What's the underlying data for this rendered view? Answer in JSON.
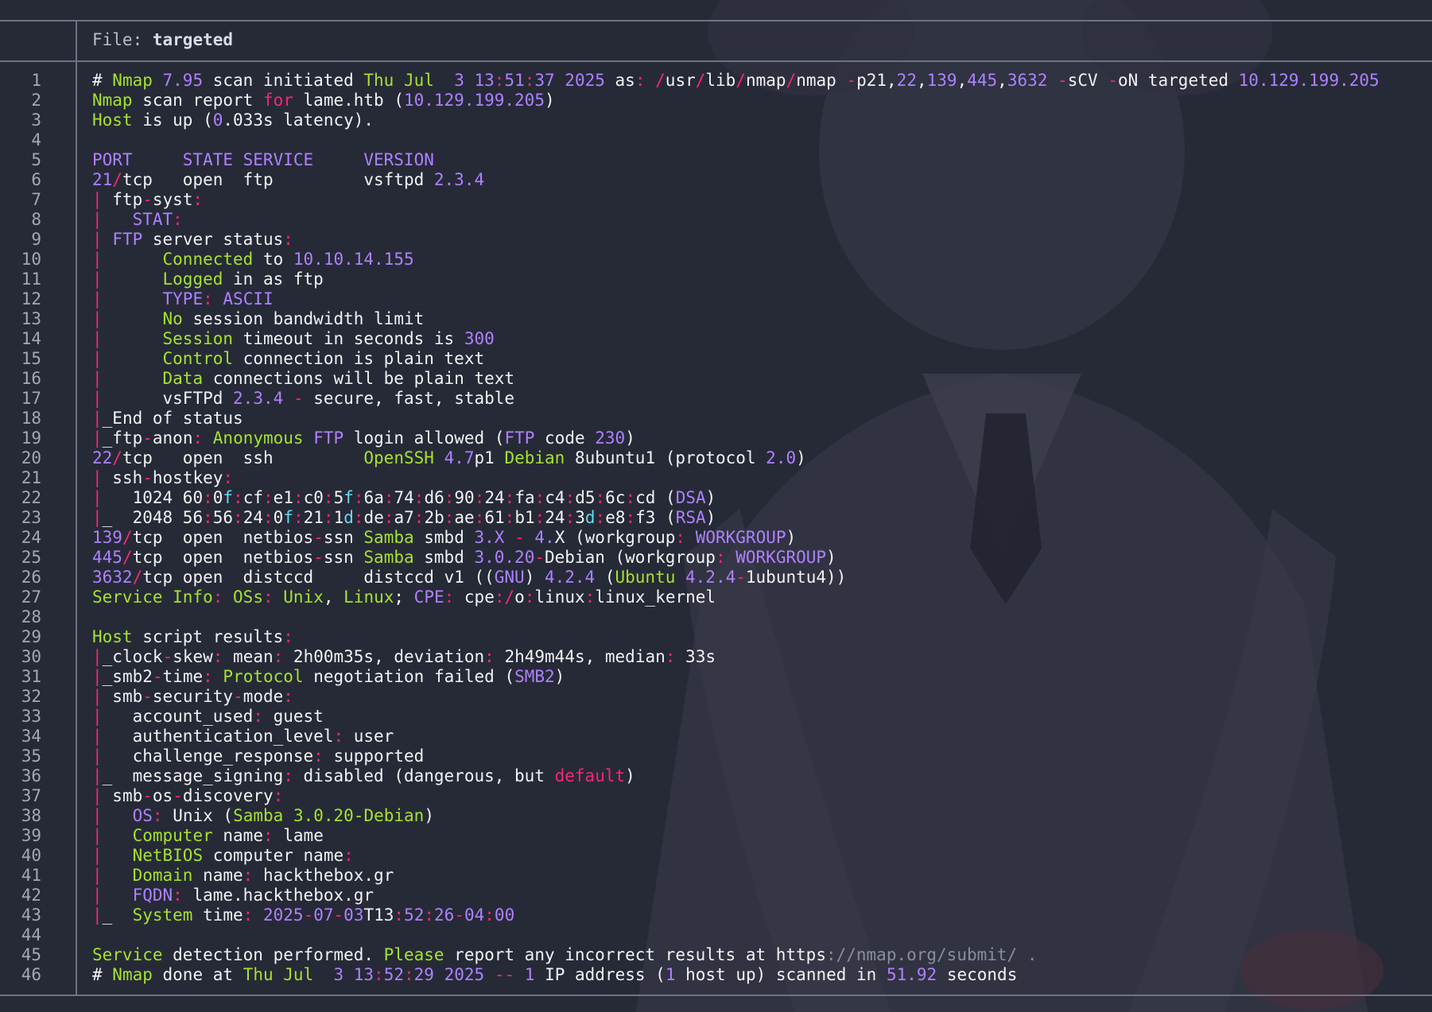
{
  "header": {
    "label": "File:",
    "filename": "targeted"
  },
  "palette": {
    "green": "#a6e22e",
    "purple": "#ae81ff",
    "red": "#f92672",
    "cyan": "#66d9ef",
    "text": "#f2f2f2",
    "background": "#262a37"
  },
  "lines": [
    [
      [
        "w",
        "# "
      ],
      [
        "g",
        "Nmap "
      ],
      [
        "p",
        "7.95"
      ],
      [
        "w",
        " scan initiated "
      ],
      [
        "g",
        "Thu Jul  "
      ],
      [
        "p",
        "3 13"
      ],
      [
        "r",
        ":"
      ],
      [
        "p",
        "51"
      ],
      [
        "r",
        ":"
      ],
      [
        "p",
        "37 2025"
      ],
      [
        "w",
        " as"
      ],
      [
        "r",
        ":"
      ],
      [
        "w",
        " "
      ],
      [
        "r",
        "/"
      ],
      [
        "w",
        "usr"
      ],
      [
        "r",
        "/"
      ],
      [
        "w",
        "lib"
      ],
      [
        "r",
        "/"
      ],
      [
        "w",
        "nmap"
      ],
      [
        "r",
        "/"
      ],
      [
        "w",
        "nmap "
      ],
      [
        "r",
        "-"
      ],
      [
        "w",
        "p21,"
      ],
      [
        "p",
        "22"
      ],
      [
        "w",
        ","
      ],
      [
        "p",
        "139"
      ],
      [
        "w",
        ","
      ],
      [
        "p",
        "445"
      ],
      [
        "w",
        ","
      ],
      [
        "p",
        "3632"
      ],
      [
        "w",
        " "
      ],
      [
        "r",
        "-"
      ],
      [
        "w",
        "sCV "
      ],
      [
        "r",
        "-"
      ],
      [
        "w",
        "oN targeted "
      ],
      [
        "p",
        "10.129.199.205"
      ]
    ],
    [
      [
        "g",
        "Nmap"
      ],
      [
        "w",
        " scan report "
      ],
      [
        "r",
        "for"
      ],
      [
        "w",
        " lame.htb ("
      ],
      [
        "p",
        "10.129.199.205"
      ],
      [
        "w",
        ")"
      ]
    ],
    [
      [
        "g",
        "Host"
      ],
      [
        "w",
        " is up ("
      ],
      [
        "p",
        "0"
      ],
      [
        "w",
        ".033s latency)."
      ]
    ],
    [],
    [
      [
        "p",
        "PORT     STATE SERVICE     VERSION"
      ]
    ],
    [
      [
        "p",
        "21"
      ],
      [
        "r",
        "/"
      ],
      [
        "w",
        "tcp   open  ftp         vsftpd "
      ],
      [
        "p",
        "2.3.4"
      ]
    ],
    [
      [
        "r",
        "|"
      ],
      [
        "w",
        " ftp"
      ],
      [
        "r",
        "-"
      ],
      [
        "w",
        "syst"
      ],
      [
        "r",
        ":"
      ]
    ],
    [
      [
        "r",
        "|"
      ],
      [
        "w",
        "   "
      ],
      [
        "p",
        "STAT"
      ],
      [
        "r",
        ":"
      ]
    ],
    [
      [
        "r",
        "|"
      ],
      [
        "w",
        " "
      ],
      [
        "p",
        "FTP"
      ],
      [
        "w",
        " server status"
      ],
      [
        "r",
        ":"
      ]
    ],
    [
      [
        "r",
        "|"
      ],
      [
        "w",
        "      "
      ],
      [
        "g",
        "Connected"
      ],
      [
        "w",
        " to "
      ],
      [
        "p",
        "10.10.14.155"
      ]
    ],
    [
      [
        "r",
        "|"
      ],
      [
        "w",
        "      "
      ],
      [
        "g",
        "Logged"
      ],
      [
        "w",
        " in as ftp"
      ]
    ],
    [
      [
        "r",
        "|"
      ],
      [
        "w",
        "      "
      ],
      [
        "p",
        "TYPE"
      ],
      [
        "r",
        ":"
      ],
      [
        "w",
        " "
      ],
      [
        "p",
        "ASCII"
      ]
    ],
    [
      [
        "r",
        "|"
      ],
      [
        "w",
        "      "
      ],
      [
        "g",
        "No"
      ],
      [
        "w",
        " session bandwidth limit"
      ]
    ],
    [
      [
        "r",
        "|"
      ],
      [
        "w",
        "      "
      ],
      [
        "g",
        "Session"
      ],
      [
        "w",
        " timeout in seconds is "
      ],
      [
        "p",
        "300"
      ]
    ],
    [
      [
        "r",
        "|"
      ],
      [
        "w",
        "      "
      ],
      [
        "g",
        "Control"
      ],
      [
        "w",
        " connection is plain text"
      ]
    ],
    [
      [
        "r",
        "|"
      ],
      [
        "w",
        "      "
      ],
      [
        "g",
        "Data"
      ],
      [
        "w",
        " connections will be plain text"
      ]
    ],
    [
      [
        "r",
        "|"
      ],
      [
        "w",
        "      vsFTPd "
      ],
      [
        "p",
        "2.3.4"
      ],
      [
        "w",
        " "
      ],
      [
        "r",
        "-"
      ],
      [
        "w",
        " secure, fast, stable"
      ]
    ],
    [
      [
        "r",
        "|"
      ],
      [
        "w",
        "_End of status"
      ]
    ],
    [
      [
        "r",
        "|"
      ],
      [
        "w",
        "_ftp"
      ],
      [
        "r",
        "-"
      ],
      [
        "w",
        "anon"
      ],
      [
        "r",
        ":"
      ],
      [
        "w",
        " "
      ],
      [
        "g",
        "Anonymous"
      ],
      [
        "w",
        " "
      ],
      [
        "p",
        "FTP"
      ],
      [
        "w",
        " login allowed ("
      ],
      [
        "p",
        "FTP"
      ],
      [
        "w",
        " code "
      ],
      [
        "p",
        "230"
      ],
      [
        "w",
        ")"
      ]
    ],
    [
      [
        "p",
        "22"
      ],
      [
        "r",
        "/"
      ],
      [
        "w",
        "tcp   open  ssh         "
      ],
      [
        "g",
        "OpenSSH"
      ],
      [
        "w",
        " "
      ],
      [
        "p",
        "4.7"
      ],
      [
        "w",
        "p1 "
      ],
      [
        "g",
        "Debian"
      ],
      [
        "w",
        " 8ubuntu1 (protocol "
      ],
      [
        "p",
        "2.0"
      ],
      [
        "w",
        ")"
      ]
    ],
    [
      [
        "r",
        "|"
      ],
      [
        "w",
        " ssh"
      ],
      [
        "r",
        "-"
      ],
      [
        "w",
        "hostkey"
      ],
      [
        "r",
        ":"
      ]
    ],
    [
      [
        "r",
        "|"
      ],
      [
        "w",
        "   1024 60"
      ],
      [
        "r",
        ":"
      ],
      [
        "w",
        "0"
      ],
      [
        "b",
        "f"
      ],
      [
        "r",
        ":"
      ],
      [
        "w",
        "cf"
      ],
      [
        "r",
        ":"
      ],
      [
        "w",
        "e1"
      ],
      [
        "r",
        ":"
      ],
      [
        "w",
        "c0"
      ],
      [
        "r",
        ":"
      ],
      [
        "w",
        "5"
      ],
      [
        "b",
        "f"
      ],
      [
        "r",
        ":"
      ],
      [
        "w",
        "6a"
      ],
      [
        "r",
        ":"
      ],
      [
        "w",
        "74"
      ],
      [
        "r",
        ":"
      ],
      [
        "w",
        "d6"
      ],
      [
        "r",
        ":"
      ],
      [
        "w",
        "90"
      ],
      [
        "r",
        ":"
      ],
      [
        "w",
        "24"
      ],
      [
        "r",
        ":"
      ],
      [
        "w",
        "fa"
      ],
      [
        "r",
        ":"
      ],
      [
        "w",
        "c4"
      ],
      [
        "r",
        ":"
      ],
      [
        "w",
        "d5"
      ],
      [
        "r",
        ":"
      ],
      [
        "w",
        "6c"
      ],
      [
        "r",
        ":"
      ],
      [
        "w",
        "cd ("
      ],
      [
        "p",
        "DSA"
      ],
      [
        "w",
        ")"
      ]
    ],
    [
      [
        "r",
        "|"
      ],
      [
        "w",
        "_  2048 56"
      ],
      [
        "r",
        ":"
      ],
      [
        "w",
        "56"
      ],
      [
        "r",
        ":"
      ],
      [
        "w",
        "24"
      ],
      [
        "r",
        ":"
      ],
      [
        "w",
        "0"
      ],
      [
        "b",
        "f"
      ],
      [
        "r",
        ":"
      ],
      [
        "w",
        "21"
      ],
      [
        "r",
        ":"
      ],
      [
        "w",
        "1"
      ],
      [
        "b",
        "d"
      ],
      [
        "r",
        ":"
      ],
      [
        "w",
        "de"
      ],
      [
        "r",
        ":"
      ],
      [
        "w",
        "a7"
      ],
      [
        "r",
        ":"
      ],
      [
        "w",
        "2b"
      ],
      [
        "r",
        ":"
      ],
      [
        "w",
        "ae"
      ],
      [
        "r",
        ":"
      ],
      [
        "w",
        "61"
      ],
      [
        "r",
        ":"
      ],
      [
        "w",
        "b1"
      ],
      [
        "r",
        ":"
      ],
      [
        "w",
        "24"
      ],
      [
        "r",
        ":"
      ],
      [
        "w",
        "3"
      ],
      [
        "b",
        "d"
      ],
      [
        "r",
        ":"
      ],
      [
        "w",
        "e8"
      ],
      [
        "r",
        ":"
      ],
      [
        "w",
        "f3 ("
      ],
      [
        "p",
        "RSA"
      ],
      [
        "w",
        ")"
      ]
    ],
    [
      [
        "p",
        "139"
      ],
      [
        "r",
        "/"
      ],
      [
        "w",
        "tcp  open  netbios"
      ],
      [
        "r",
        "-"
      ],
      [
        "w",
        "ssn "
      ],
      [
        "g",
        "Samba"
      ],
      [
        "w",
        " smbd "
      ],
      [
        "p",
        "3.X"
      ],
      [
        "w",
        " "
      ],
      [
        "r",
        "-"
      ],
      [
        "w",
        " "
      ],
      [
        "p",
        "4."
      ],
      [
        "w",
        "X (workgroup"
      ],
      [
        "r",
        ":"
      ],
      [
        "w",
        " "
      ],
      [
        "p",
        "WORKGROUP"
      ],
      [
        "w",
        ")"
      ]
    ],
    [
      [
        "p",
        "445"
      ],
      [
        "r",
        "/"
      ],
      [
        "w",
        "tcp  open  netbios"
      ],
      [
        "r",
        "-"
      ],
      [
        "w",
        "ssn "
      ],
      [
        "g",
        "Samba"
      ],
      [
        "w",
        " smbd "
      ],
      [
        "p",
        "3.0.20"
      ],
      [
        "r",
        "-"
      ],
      [
        "w",
        "Debian (workgroup"
      ],
      [
        "r",
        ":"
      ],
      [
        "w",
        " "
      ],
      [
        "p",
        "WORKGROUP"
      ],
      [
        "w",
        ")"
      ]
    ],
    [
      [
        "p",
        "3632"
      ],
      [
        "r",
        "/"
      ],
      [
        "w",
        "tcp open  distccd     distccd v1 (("
      ],
      [
        "p",
        "GNU"
      ],
      [
        "w",
        ") "
      ],
      [
        "p",
        "4.2.4"
      ],
      [
        "w",
        " ("
      ],
      [
        "g",
        "Ubuntu"
      ],
      [
        "w",
        " "
      ],
      [
        "p",
        "4.2.4"
      ],
      [
        "r",
        "-"
      ],
      [
        "w",
        "1ubuntu4))"
      ]
    ],
    [
      [
        "g",
        "Service Info"
      ],
      [
        "r",
        ":"
      ],
      [
        "w",
        " "
      ],
      [
        "g",
        "OSs"
      ],
      [
        "r",
        ":"
      ],
      [
        "w",
        " "
      ],
      [
        "g",
        "Unix"
      ],
      [
        "w",
        ", "
      ],
      [
        "g",
        "Linux"
      ],
      [
        "w",
        "; "
      ],
      [
        "p",
        "CPE"
      ],
      [
        "r",
        ":"
      ],
      [
        "w",
        " cpe"
      ],
      [
        "r",
        ":/"
      ],
      [
        "w",
        "o"
      ],
      [
        "r",
        ":"
      ],
      [
        "w",
        "linux"
      ],
      [
        "r",
        ":"
      ],
      [
        "w",
        "linux_kernel"
      ]
    ],
    [],
    [
      [
        "g",
        "Host"
      ],
      [
        "w",
        " script results"
      ],
      [
        "r",
        ":"
      ]
    ],
    [
      [
        "r",
        "|"
      ],
      [
        "w",
        "_clock"
      ],
      [
        "r",
        "-"
      ],
      [
        "w",
        "skew"
      ],
      [
        "r",
        ":"
      ],
      [
        "w",
        " mean"
      ],
      [
        "r",
        ":"
      ],
      [
        "w",
        " 2h00m35s, deviation"
      ],
      [
        "r",
        ":"
      ],
      [
        "w",
        " 2h49m44s, median"
      ],
      [
        "r",
        ":"
      ],
      [
        "w",
        " 33s"
      ]
    ],
    [
      [
        "r",
        "|"
      ],
      [
        "w",
        "_smb2"
      ],
      [
        "r",
        "-"
      ],
      [
        "w",
        "time"
      ],
      [
        "r",
        ":"
      ],
      [
        "w",
        " "
      ],
      [
        "g",
        "Protocol"
      ],
      [
        "w",
        " negotiation failed ("
      ],
      [
        "p",
        "SMB2"
      ],
      [
        "w",
        ")"
      ]
    ],
    [
      [
        "r",
        "|"
      ],
      [
        "w",
        " smb"
      ],
      [
        "r",
        "-"
      ],
      [
        "w",
        "security"
      ],
      [
        "r",
        "-"
      ],
      [
        "w",
        "mode"
      ],
      [
        "r",
        ":"
      ]
    ],
    [
      [
        "r",
        "|"
      ],
      [
        "w",
        "   account_used"
      ],
      [
        "r",
        ":"
      ],
      [
        "w",
        " guest"
      ]
    ],
    [
      [
        "r",
        "|"
      ],
      [
        "w",
        "   authentication_level"
      ],
      [
        "r",
        ":"
      ],
      [
        "w",
        " user"
      ]
    ],
    [
      [
        "r",
        "|"
      ],
      [
        "w",
        "   challenge_response"
      ],
      [
        "r",
        ":"
      ],
      [
        "w",
        " supported"
      ]
    ],
    [
      [
        "r",
        "|"
      ],
      [
        "w",
        "_  message_signing"
      ],
      [
        "r",
        ":"
      ],
      [
        "w",
        " disabled (dangerous, but "
      ],
      [
        "r",
        "default"
      ],
      [
        "w",
        ")"
      ]
    ],
    [
      [
        "r",
        "|"
      ],
      [
        "w",
        " smb"
      ],
      [
        "r",
        "-"
      ],
      [
        "w",
        "os"
      ],
      [
        "r",
        "-"
      ],
      [
        "w",
        "discovery"
      ],
      [
        "r",
        ":"
      ]
    ],
    [
      [
        "r",
        "|"
      ],
      [
        "w",
        "   "
      ],
      [
        "p",
        "OS"
      ],
      [
        "r",
        ":"
      ],
      [
        "w",
        " Unix ("
      ],
      [
        "g",
        "Samba"
      ],
      [
        "w",
        " "
      ],
      [
        "g",
        "3.0.20-Debian"
      ],
      [
        "w",
        ")"
      ]
    ],
    [
      [
        "r",
        "|"
      ],
      [
        "w",
        "   "
      ],
      [
        "g",
        "Computer"
      ],
      [
        "w",
        " name"
      ],
      [
        "r",
        ":"
      ],
      [
        "w",
        " lame"
      ]
    ],
    [
      [
        "r",
        "|"
      ],
      [
        "w",
        "   "
      ],
      [
        "g",
        "NetBIOS"
      ],
      [
        "w",
        " computer name"
      ],
      [
        "r",
        ":"
      ]
    ],
    [
      [
        "r",
        "|"
      ],
      [
        "w",
        "   "
      ],
      [
        "g",
        "Domain"
      ],
      [
        "w",
        " name"
      ],
      [
        "r",
        ":"
      ],
      [
        "w",
        " hackthebox.gr"
      ]
    ],
    [
      [
        "r",
        "|"
      ],
      [
        "w",
        "   "
      ],
      [
        "p",
        "FQDN"
      ],
      [
        "r",
        ":"
      ],
      [
        "w",
        " lame.hackthebox.gr"
      ]
    ],
    [
      [
        "r",
        "|"
      ],
      [
        "w",
        "_  "
      ],
      [
        "g",
        "System"
      ],
      [
        "w",
        " time"
      ],
      [
        "r",
        ":"
      ],
      [
        "w",
        " "
      ],
      [
        "p",
        "2025"
      ],
      [
        "r",
        "-"
      ],
      [
        "p",
        "07"
      ],
      [
        "r",
        "-"
      ],
      [
        "p",
        "03"
      ],
      [
        "w",
        "T13"
      ],
      [
        "r",
        ":"
      ],
      [
        "p",
        "52"
      ],
      [
        "r",
        ":"
      ],
      [
        "p",
        "26"
      ],
      [
        "r",
        "-"
      ],
      [
        "p",
        "04"
      ],
      [
        "r",
        ":"
      ],
      [
        "p",
        "00"
      ]
    ],
    [],
    [
      [
        "g",
        "Service"
      ],
      [
        "w",
        " detection performed. "
      ],
      [
        "g",
        "Please"
      ],
      [
        "w",
        " report any incorrect results at https"
      ],
      [
        "m",
        "://nmap.org/submit/ ."
      ]
    ],
    [
      [
        "w",
        "# "
      ],
      [
        "g",
        "Nmap"
      ],
      [
        "w",
        " done at "
      ],
      [
        "g",
        "Thu Jul  "
      ],
      [
        "p",
        "3 13"
      ],
      [
        "r",
        ":"
      ],
      [
        "p",
        "52"
      ],
      [
        "r",
        ":"
      ],
      [
        "p",
        "29 2025"
      ],
      [
        "w",
        " "
      ],
      [
        "r",
        "--"
      ],
      [
        "w",
        " "
      ],
      [
        "p",
        "1"
      ],
      [
        "w",
        " IP address ("
      ],
      [
        "p",
        "1"
      ],
      [
        "w",
        " host up) scanned in "
      ],
      [
        "p",
        "51.92"
      ],
      [
        "w",
        " seconds"
      ]
    ]
  ]
}
